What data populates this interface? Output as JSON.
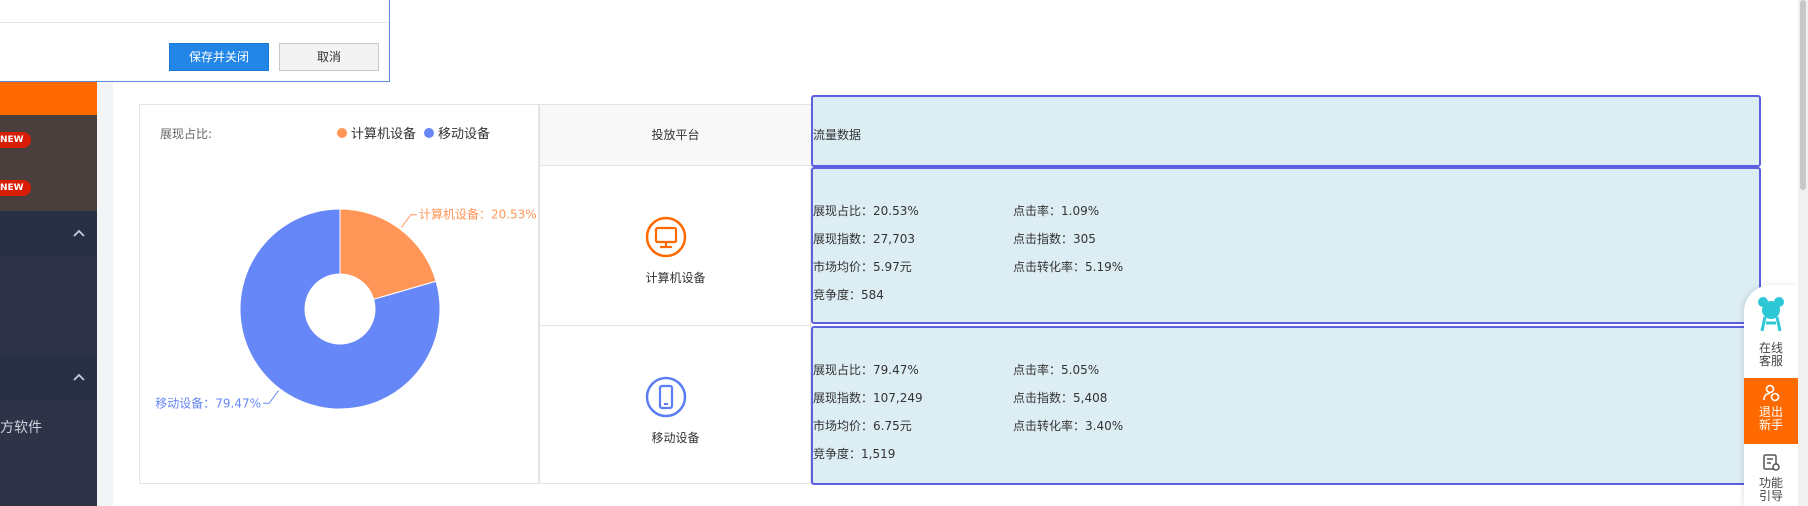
{
  "dialog": {
    "save_label": "保存并关闭",
    "cancel_label": "取消"
  },
  "sidebar": {
    "badges": [
      "NEW",
      "NEW"
    ],
    "partial_item_label": "方软件"
  },
  "chart_card": {
    "label": "展现占比:",
    "legend": [
      {
        "name": "计算机设备",
        "color": "#ff9658"
      },
      {
        "name": "移动设备",
        "color": "#6687f7"
      }
    ]
  },
  "chart_data": {
    "type": "pie",
    "title": "展现占比:",
    "donut": true,
    "slices": [
      {
        "label": "计算机设备",
        "value": 20.53,
        "display": "计算机设备：20.53%",
        "color": "#ff9658"
      },
      {
        "label": "移动设备",
        "value": 79.47,
        "display": "移动设备：79.47%",
        "color": "#6687f7"
      }
    ],
    "legend_position": "top-right"
  },
  "table": {
    "header_platform": "投放平台",
    "header_traffic": "流量数据",
    "rows": [
      {
        "device": "计算机设备",
        "icon": "monitor-icon",
        "color": "#ff6a00",
        "metrics": {
          "impression_share": "展现占比：20.53%",
          "ctr": "点击率：1.09%",
          "impression_index": "展现指数：27,703",
          "click_index": "点击指数：305",
          "avg_price": "市场均价：5.97元",
          "conversion_rate": "点击转化率：5.19%",
          "competition": "竞争度：584"
        }
      },
      {
        "device": "移动设备",
        "icon": "mobile-phone-icon",
        "color": "#5b7ff2",
        "metrics": {
          "impression_share": "展现占比：79.47%",
          "ctr": "点击率：5.05%",
          "impression_index": "展现指数：107,249",
          "click_index": "点击指数：5,408",
          "avg_price": "市场均价：6.75元",
          "conversion_rate": "点击转化率：3.40%",
          "competition": "竞争度：1,519"
        }
      }
    ]
  },
  "floatbar": {
    "online_service": "在线客服",
    "exit_novice": "退出新手",
    "feature_guide": "功能引导"
  }
}
